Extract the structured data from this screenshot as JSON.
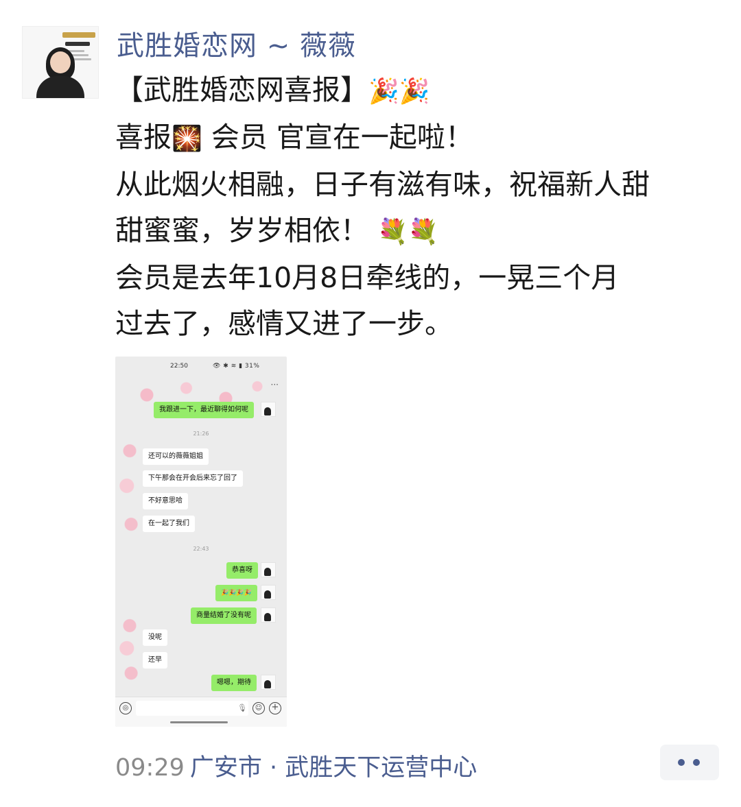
{
  "post": {
    "author": "武胜婚恋网 ~ 薇薇",
    "lines": {
      "l1": "【武胜婚恋网喜报】",
      "l1_emoji": "🎉🎉",
      "l2a": "喜报",
      "l2_emoji": "🎇",
      "l2b": " 会员 官宣在一起啦！",
      "l3": "从此烟火相融，日子有滋有味，祝福新人甜",
      "l4": "甜蜜蜜，岁岁相依！ ",
      "l4_emoji": "💐💐",
      "l5": "会员是去年10月8日牵线的，一晃三个月",
      "l6": "过去了，感情又进了一步。"
    },
    "time": "09:29",
    "location": "广安市 · 武胜天下运营中心"
  },
  "screenshot": {
    "status_time": "22:50",
    "status_icons": "👁 ✱ ≋ ▮ 31%",
    "more": "···",
    "ts1": "21:26",
    "ts2": "22:43",
    "msgs": {
      "m1": "我跟进一下，最近聊得如何呢",
      "m2": "还可以的薇薇姐姐",
      "m3": "下午那会在开会后来忘了回了",
      "m4": "不好意思哈",
      "m5": "在一起了我们",
      "m6": "恭喜呀",
      "m7": "🎉🎉🎉🎉",
      "m8": "商量结婚了没有呢",
      "m9": "没呢",
      "m10": "还早",
      "m11": "嗯嗯，期待"
    }
  },
  "icons": {
    "voice": "voice-icon",
    "mic": "mic-icon",
    "emoji": "emoji-icon",
    "plus": "plus-icon",
    "more": "more-dots-icon"
  }
}
